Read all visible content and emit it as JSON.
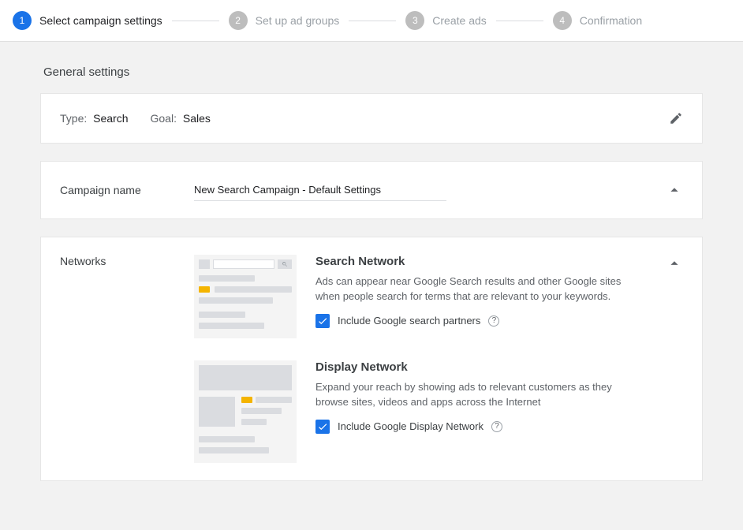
{
  "stepper": {
    "steps": [
      {
        "num": "1",
        "label": "Select campaign settings",
        "active": true
      },
      {
        "num": "2",
        "label": "Set up ad groups",
        "active": false
      },
      {
        "num": "3",
        "label": "Create ads",
        "active": false
      },
      {
        "num": "4",
        "label": "Confirmation",
        "active": false
      }
    ]
  },
  "section_title": "General settings",
  "summary": {
    "type_label": "Type:",
    "type_value": "Search",
    "goal_label": "Goal:",
    "goal_value": "Sales"
  },
  "campaign_name": {
    "label": "Campaign name",
    "value": "New Search Campaign - Default Settings"
  },
  "networks": {
    "label": "Networks",
    "search": {
      "title": "Search Network",
      "desc": "Ads can appear near Google Search results and other Google sites when people search for terms that are relevant to your keywords.",
      "checkbox_label": "Include Google search partners",
      "checked": true
    },
    "display": {
      "title": "Display Network",
      "desc": "Expand your reach by showing ads to relevant customers as they browse sites, videos and apps across the Internet",
      "checkbox_label": "Include Google Display Network",
      "checked": true
    }
  }
}
